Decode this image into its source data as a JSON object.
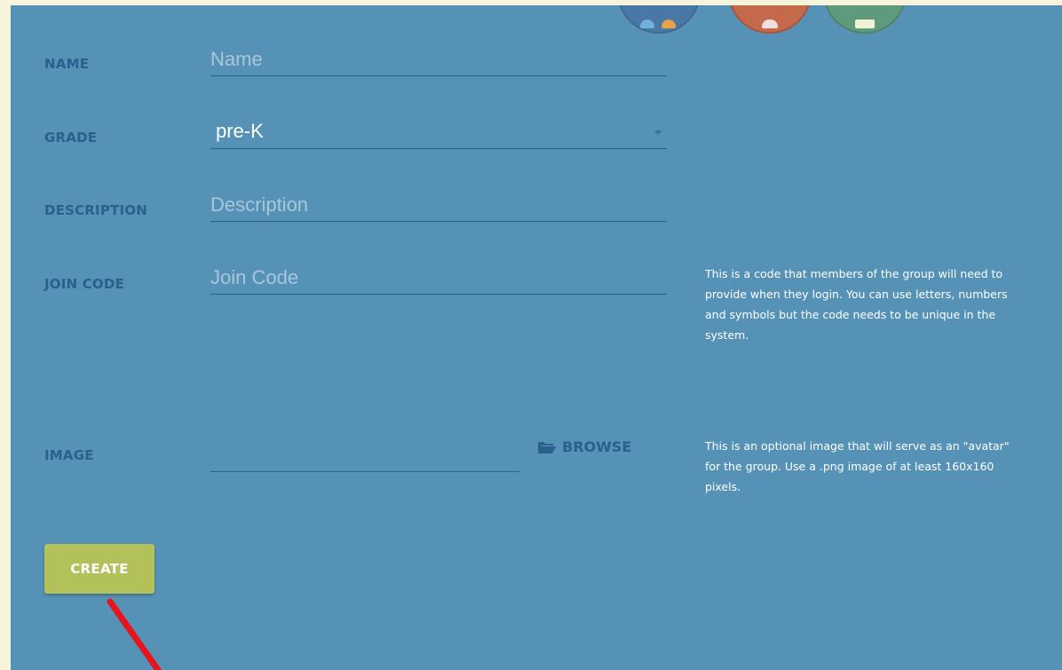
{
  "form": {
    "name": {
      "label": "NAME",
      "placeholder": "Name",
      "value": ""
    },
    "grade": {
      "label": "GRADE",
      "value": "pre-K"
    },
    "description": {
      "label": "DESCRIPTION",
      "placeholder": "Description",
      "value": ""
    },
    "join_code": {
      "label": "JOIN CODE",
      "placeholder": "Join Code",
      "value": "",
      "help": "This is a code that members of the group will need to provide when they login. You can use letters, numbers and symbols but the code needs to be unique in the system."
    },
    "image": {
      "label": "IMAGE",
      "value": "",
      "browse_label": "BROWSE",
      "help": "This is an optional image that will serve as an \"avatar\" for the group. Use a .png image of at least 160x160 pixels."
    },
    "create_label": "CREATE"
  },
  "icons": {
    "folder": "folder-open-icon",
    "dropdown": "caret-down-icon",
    "avatars": [
      "group-avatar-icon-blue",
      "group-avatar-icon-red",
      "group-avatar-icon-green"
    ]
  },
  "colors": {
    "panel_background": "#5592b6",
    "label_text": "#2b5f8c",
    "create_button": "#b2c15a",
    "annotation_arrow": "#e8141b"
  }
}
